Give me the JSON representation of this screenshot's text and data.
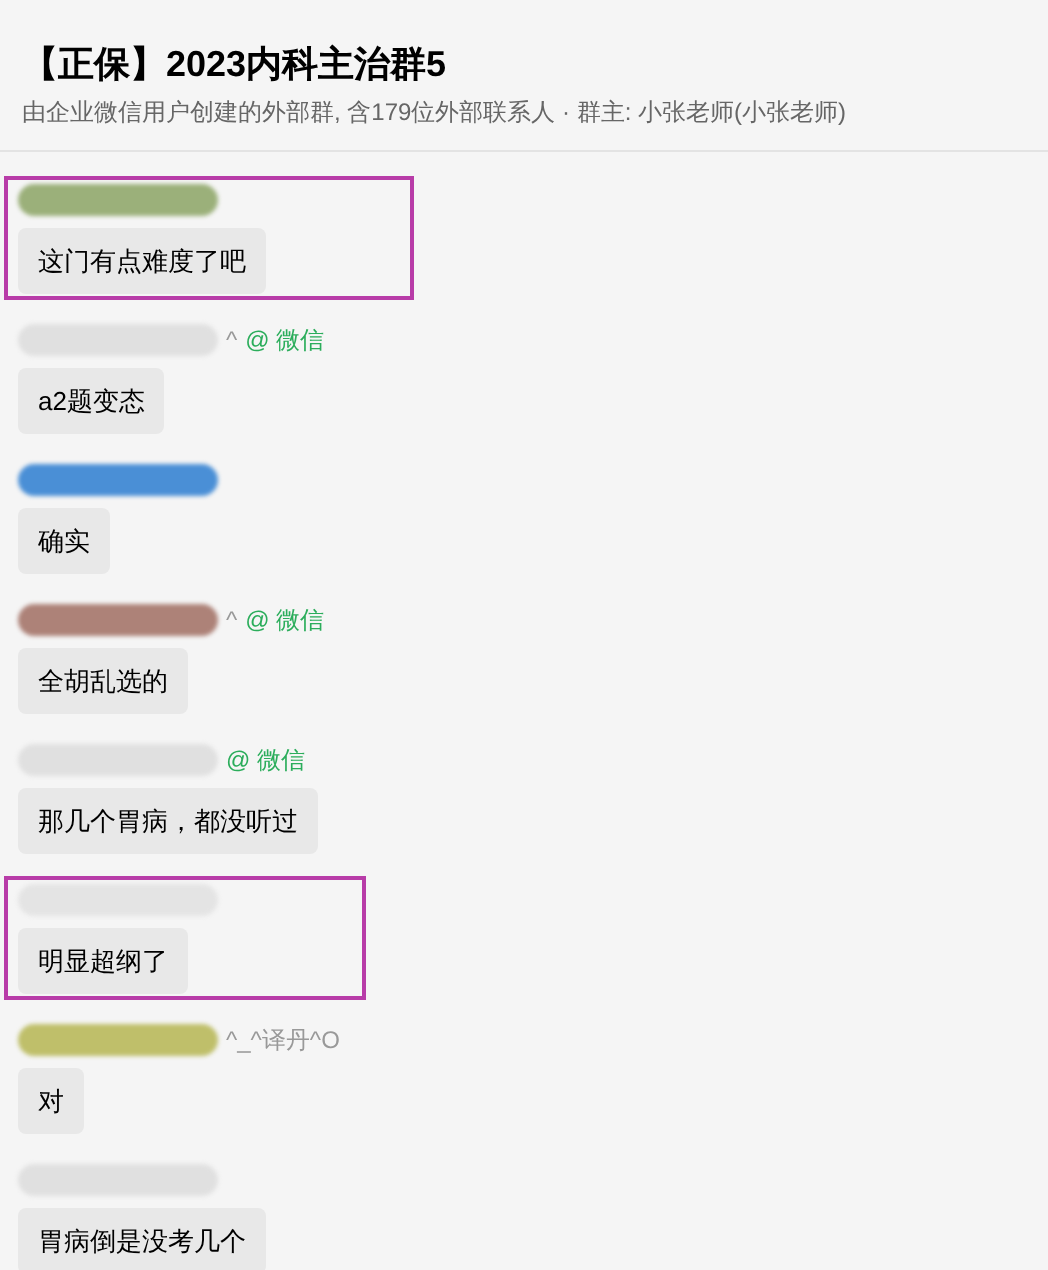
{
  "header": {
    "title": "【正保】2023内科主治群5",
    "subtitle": "由企业微信用户创建的外部群, 含179位外部联系人 · 群主: 小张老师(小张老师)"
  },
  "messages": [
    {
      "sender_redacted": true,
      "color": "#9bb07a",
      "highlighted": true,
      "text": "这门有点难度了吧"
    },
    {
      "sender": "^",
      "sender_redacted": true,
      "color": "#e0e0e0",
      "tag": "@ 微信",
      "highlighted": false,
      "text": "a2题变态"
    },
    {
      "sender_redacted": true,
      "color": "#4a8fd6",
      "highlighted": false,
      "text": "确实"
    },
    {
      "sender": "^",
      "sender_redacted": true,
      "color": "#ad8278",
      "tag": "@ 微信",
      "highlighted": false,
      "text": "全胡乱选的"
    },
    {
      "sender_redacted": true,
      "color": "#e0e0e0",
      "tag": "@ 微信",
      "highlighted": false,
      "text": "那几个胃病，都没听过"
    },
    {
      "sender_redacted": true,
      "color": "#e4e4e4",
      "highlighted": true,
      "text": "明显超纲了"
    },
    {
      "sender": "^_^译丹^O",
      "sender_redacted": true,
      "color": "#bfbf6a",
      "highlighted": false,
      "text": "对"
    },
    {
      "sender_redacted": true,
      "color": "#e0e0e0",
      "highlighted": false,
      "text": "胃病倒是没考几个"
    }
  ]
}
